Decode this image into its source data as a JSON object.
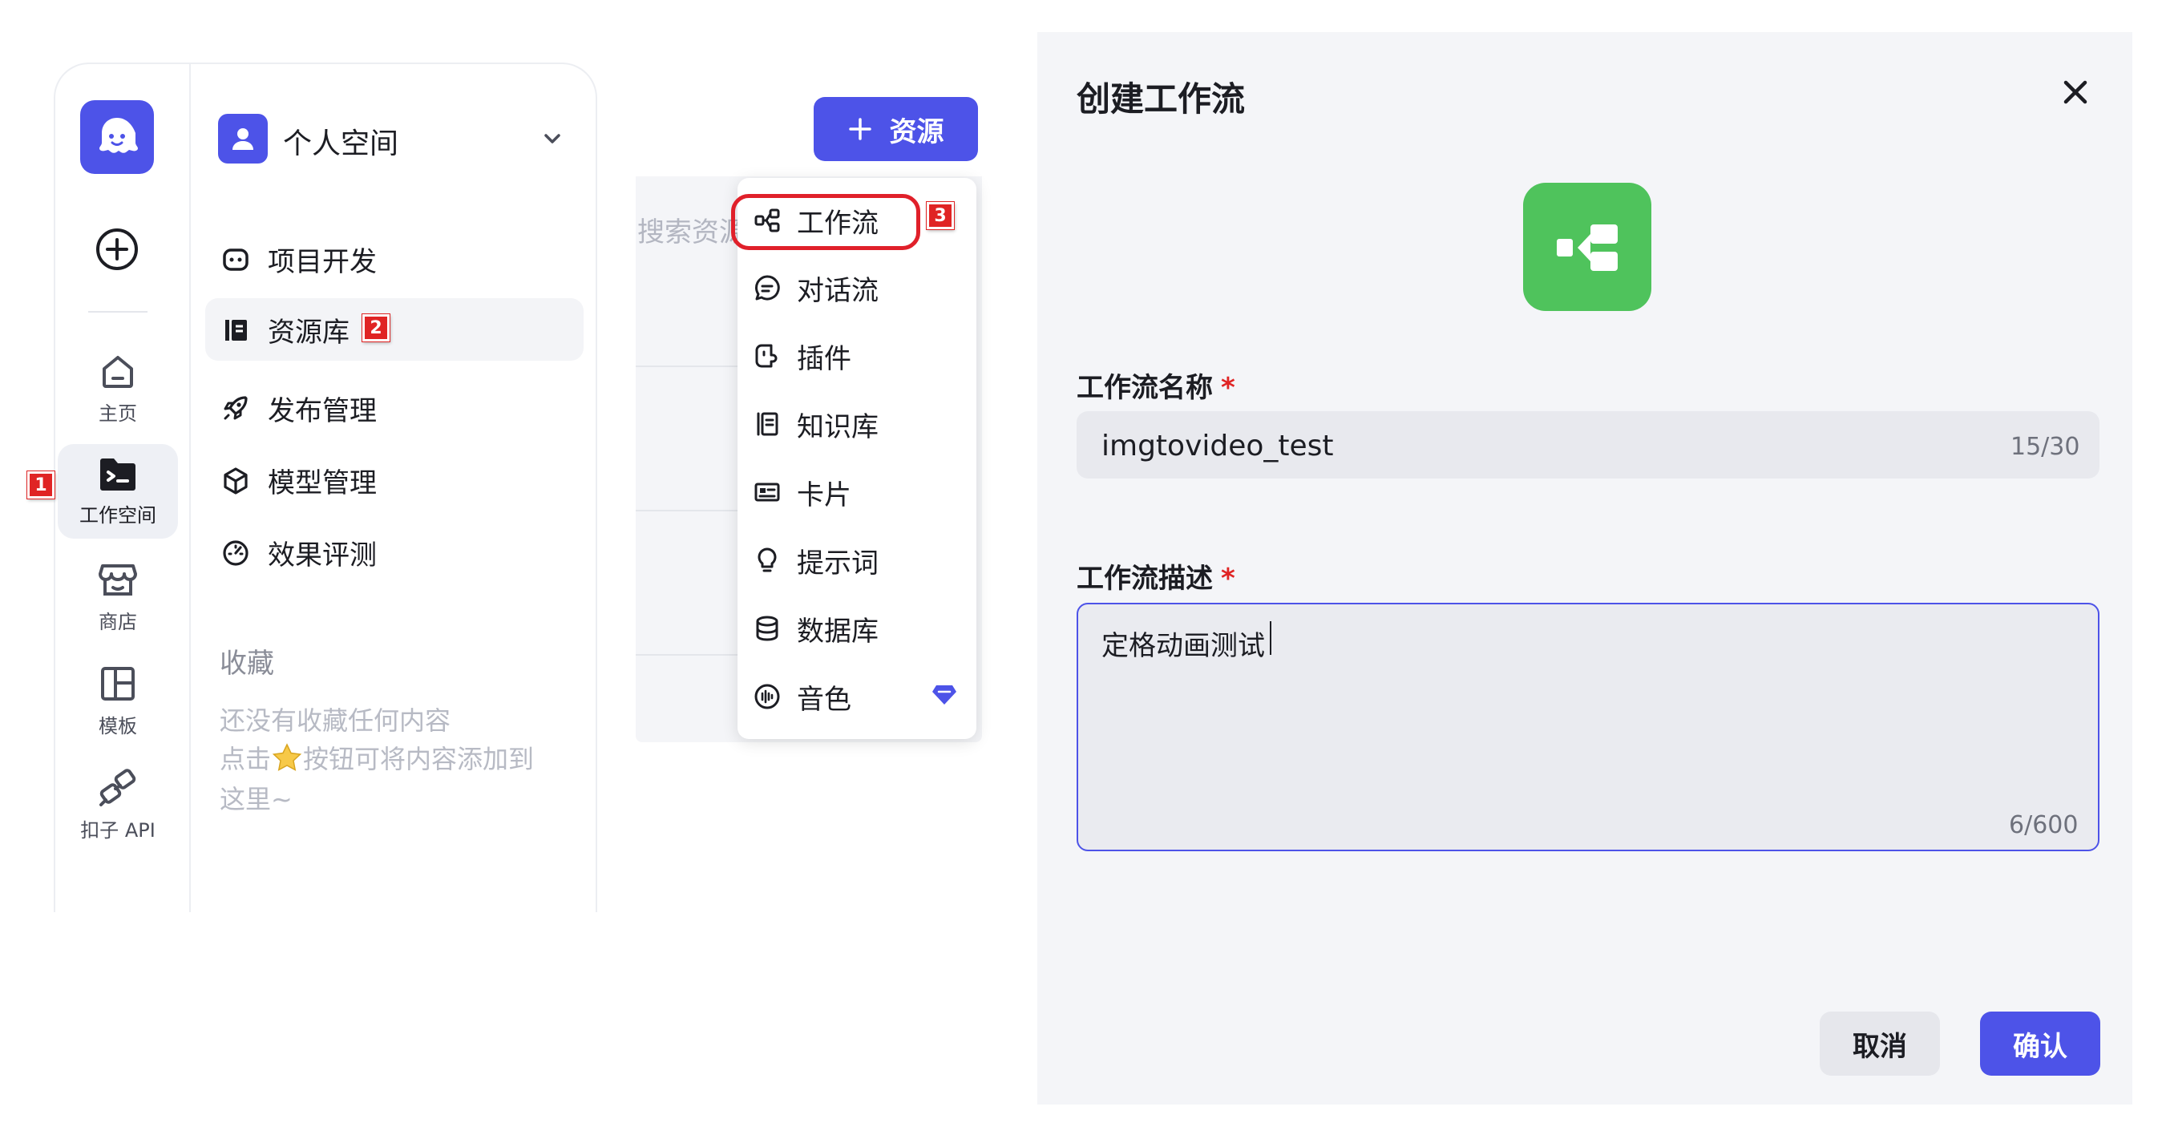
{
  "sidebar_rail": {
    "items": [
      {
        "label": "主页"
      },
      {
        "label": "工作空间"
      },
      {
        "label": "商店"
      },
      {
        "label": "模板"
      },
      {
        "label": "扣子 API"
      }
    ]
  },
  "workspace": {
    "name": "个人空间",
    "nav": [
      {
        "label": "项目开发"
      },
      {
        "label": "资源库"
      },
      {
        "label": "发布管理"
      },
      {
        "label": "模型管理"
      },
      {
        "label": "效果评测"
      }
    ],
    "favorites": {
      "title": "收藏",
      "empty_line1": "还没有收藏任何内容",
      "empty_line2a": "点击",
      "empty_line2b": "按钮可将内容添加到",
      "empty_line3": "这里~"
    }
  },
  "resources": {
    "add_button": "资源",
    "search_placeholder": "搜索资源",
    "menu": [
      {
        "label": "工作流"
      },
      {
        "label": "对话流"
      },
      {
        "label": "插件"
      },
      {
        "label": "知识库"
      },
      {
        "label": "卡片"
      },
      {
        "label": "提示词"
      },
      {
        "label": "数据库"
      },
      {
        "label": "音色"
      }
    ]
  },
  "steps": [
    "1",
    "2",
    "3"
  ],
  "dialog": {
    "title": "创建工作流",
    "name_label": "工作流名称",
    "name_value": "imgtovideo_test",
    "name_count": "15/30",
    "desc_label": "工作流描述",
    "desc_value": "定格动画测试",
    "desc_count": "6/600",
    "required_mark": "*",
    "cancel": "取消",
    "confirm": "确认"
  },
  "colors": {
    "primary": "#4d53e8",
    "workflow_icon": "#4fc35c",
    "step_badge": "#e02424",
    "highlight": "#e0202a"
  }
}
